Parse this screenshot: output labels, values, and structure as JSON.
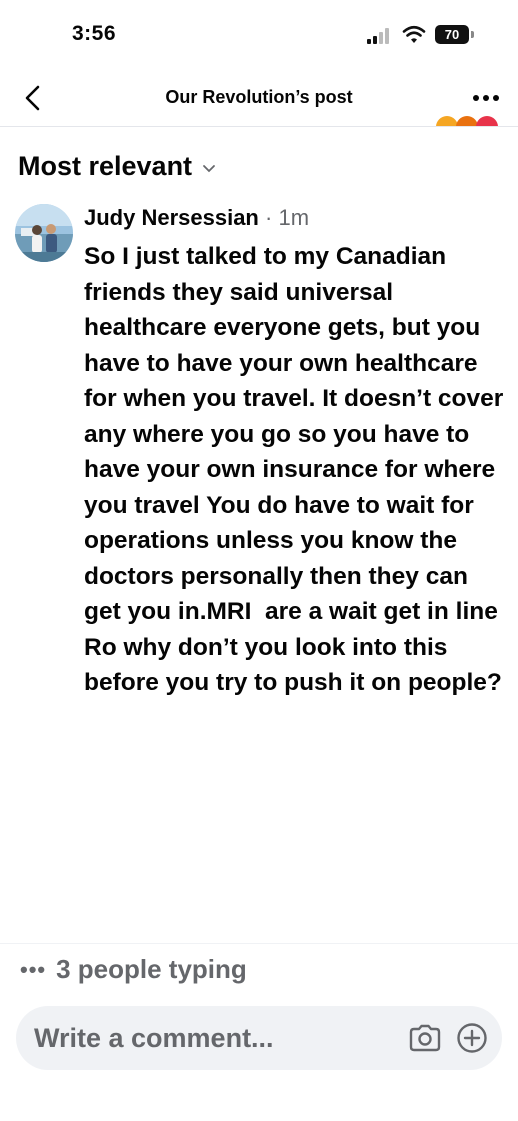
{
  "status_bar": {
    "time": "3:56",
    "battery_level": "70"
  },
  "header": {
    "title": "Our Revolution’s post"
  },
  "reaction_colors": [
    "#f5a623",
    "#e9710f",
    "#e8334a"
  ],
  "sort": {
    "label": "Most relevant"
  },
  "comment": {
    "author": "Judy Nersessian",
    "separator": "·",
    "time": "1m",
    "text": "So I just talked to my Canadian friends they said universal healthcare everyone gets, but you have to have your own healthcare for when you travel. It doesn’t cover any where you go so you have to have your own insurance for where you travel You do have to wait for operations unless you know the doctors personally then they can get you in.MRI  are a wait get in line Ro why don’t you look into this before you try to push it on people?"
  },
  "typing": {
    "dots": "•••",
    "text": "3 people typing"
  },
  "composer": {
    "placeholder": "Write a comment..."
  },
  "colors": {
    "text": "#050505",
    "secondary": "#65676b",
    "input_bg": "#f0f2f5"
  }
}
